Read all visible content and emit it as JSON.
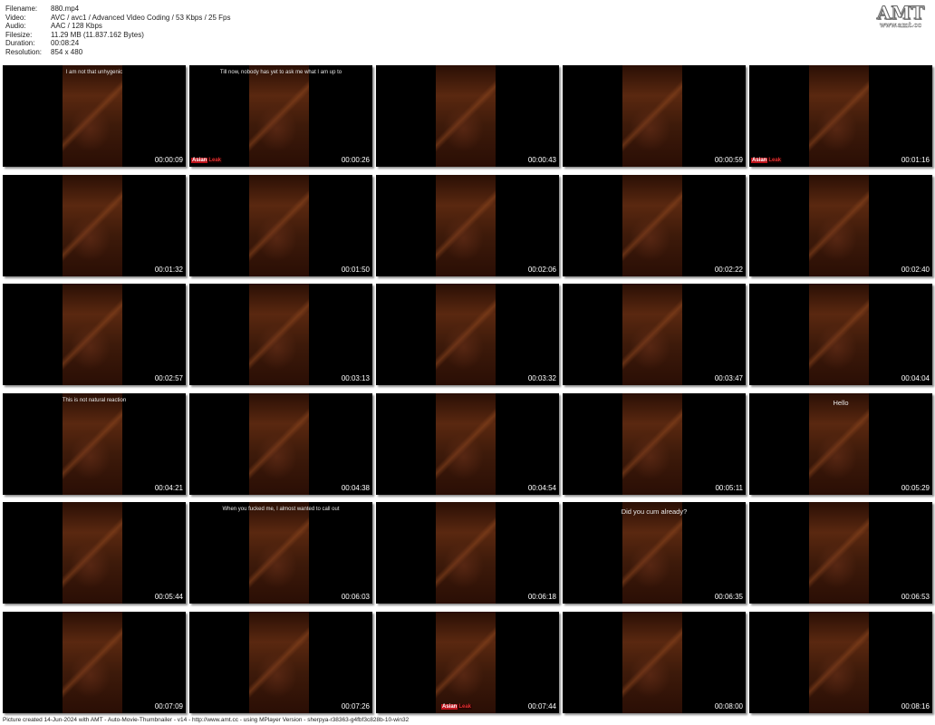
{
  "info": {
    "filename_label": "Filename:",
    "filename": "880.mp4",
    "video_label": "Video:",
    "video": "AVC / avc1 / Advanced Video Coding / 53 Kbps / 25 Fps",
    "audio_label": "Audio:",
    "audio": "AAC / 128 Kbps",
    "filesize_label": "Filesize:",
    "filesize": "11.29 MB (11.837.162 Bytes)",
    "duration_label": "Duration:",
    "duration": "00:08:24",
    "resolution_label": "Resolution:",
    "resolution": "854 x 480"
  },
  "logo": {
    "main": "AMT",
    "sub": "www.amt.cc"
  },
  "thumbnails": [
    {
      "time": "00:00:09",
      "subtitle": "I am not that unhygenic",
      "watermark": false
    },
    {
      "time": "00:00:26",
      "subtitle": "Till now, nobody has yet to ask me what I am up to",
      "watermark": true
    },
    {
      "time": "00:00:43",
      "subtitle": "",
      "watermark": false
    },
    {
      "time": "00:00:59",
      "subtitle": "",
      "watermark": false
    },
    {
      "time": "00:01:16",
      "subtitle": "",
      "watermark": true
    },
    {
      "time": "00:01:32",
      "subtitle": "",
      "watermark": false
    },
    {
      "time": "00:01:50",
      "subtitle": "",
      "watermark": false
    },
    {
      "time": "00:02:06",
      "subtitle": "",
      "watermark": false
    },
    {
      "time": "00:02:22",
      "subtitle": "",
      "watermark": false
    },
    {
      "time": "00:02:40",
      "subtitle": "",
      "watermark": false
    },
    {
      "time": "00:02:57",
      "subtitle": "",
      "watermark": false
    },
    {
      "time": "00:03:13",
      "subtitle": "",
      "watermark": false
    },
    {
      "time": "00:03:32",
      "subtitle": "",
      "watermark": false
    },
    {
      "time": "00:03:47",
      "subtitle": "",
      "watermark": false
    },
    {
      "time": "00:04:04",
      "subtitle": "",
      "watermark": false
    },
    {
      "time": "00:04:21",
      "subtitle": "This is not natural reaction",
      "watermark": false
    },
    {
      "time": "00:04:38",
      "subtitle": "",
      "watermark": false
    },
    {
      "time": "00:04:54",
      "subtitle": "",
      "watermark": false
    },
    {
      "time": "00:05:11",
      "subtitle": "",
      "watermark": false
    },
    {
      "time": "00:05:29",
      "subtitle": "Hello",
      "watermark": false,
      "large": true
    },
    {
      "time": "00:05:44",
      "subtitle": "",
      "watermark": false
    },
    {
      "time": "00:06:03",
      "subtitle": "When you fucked me, I almost wanted to call out",
      "watermark": false
    },
    {
      "time": "00:06:18",
      "subtitle": "",
      "watermark": false
    },
    {
      "time": "00:06:35",
      "subtitle": "Did you cum already?",
      "watermark": false,
      "large": true
    },
    {
      "time": "00:06:53",
      "subtitle": "",
      "watermark": false
    },
    {
      "time": "00:07:09",
      "subtitle": "",
      "watermark": false
    },
    {
      "time": "00:07:26",
      "subtitle": "",
      "watermark": false
    },
    {
      "time": "00:07:44",
      "subtitle": "",
      "watermark": true,
      "watermark_center": true
    },
    {
      "time": "00:08:00",
      "subtitle": "",
      "watermark": false
    },
    {
      "time": "00:08:16",
      "subtitle": "",
      "watermark": false
    }
  ],
  "watermark_text": {
    "a": "Asian",
    "b": "Leak"
  },
  "footer": "Picture created 14-Jun-2024 with AMT - Auto-Movie-Thumbnailer - v14 - http://www.amt.cc - using MPlayer Version - sherpya-r38363-g4fbf3c828b-10-win32"
}
